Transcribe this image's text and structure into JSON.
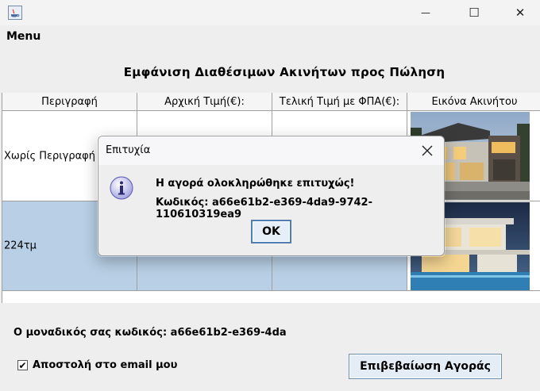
{
  "window": {
    "minimize_glyph": "—",
    "maximize_glyph": "☐",
    "close_glyph": "✕"
  },
  "menu": {
    "label": "Menu"
  },
  "panel": {
    "title": "Εμφάνιση Διαθέσιμων Ακινήτων προς Πώληση"
  },
  "table": {
    "headers": [
      "Περιγραφή",
      "Αρχική Τιμή(€):",
      "Τελική Τιμή με ΦΠΑ(€):",
      "Εικόνα Ακινήτου"
    ],
    "rows": [
      {
        "description": "Χωρίς Περιγραφή",
        "initial_price": "",
        "final_price": ""
      },
      {
        "description": "224τμ",
        "initial_price": "",
        "final_price": ""
      }
    ]
  },
  "footer": {
    "code_text": "Ο μοναδικός σας κωδικός: a66e61b2-e369-4da",
    "email_checkbox_checked": true,
    "email_checkbox_label": "Αποστολή στο email μου",
    "confirm_button": "Επιβεβαίωση Αγοράς"
  },
  "dialog": {
    "title": "Επιτυχία",
    "message_line1": "Η αγορά ολοκληρώθηκε επιτυχώς!",
    "message_line2": "Κωδικός: a66e61b2-e369-4da9-9742-110610319ea9",
    "ok_button": "OK"
  },
  "colors": {
    "selected_row": "#b8cfe5",
    "button_border": "#4f7fb2",
    "dialog_background": "#eeeeee"
  }
}
